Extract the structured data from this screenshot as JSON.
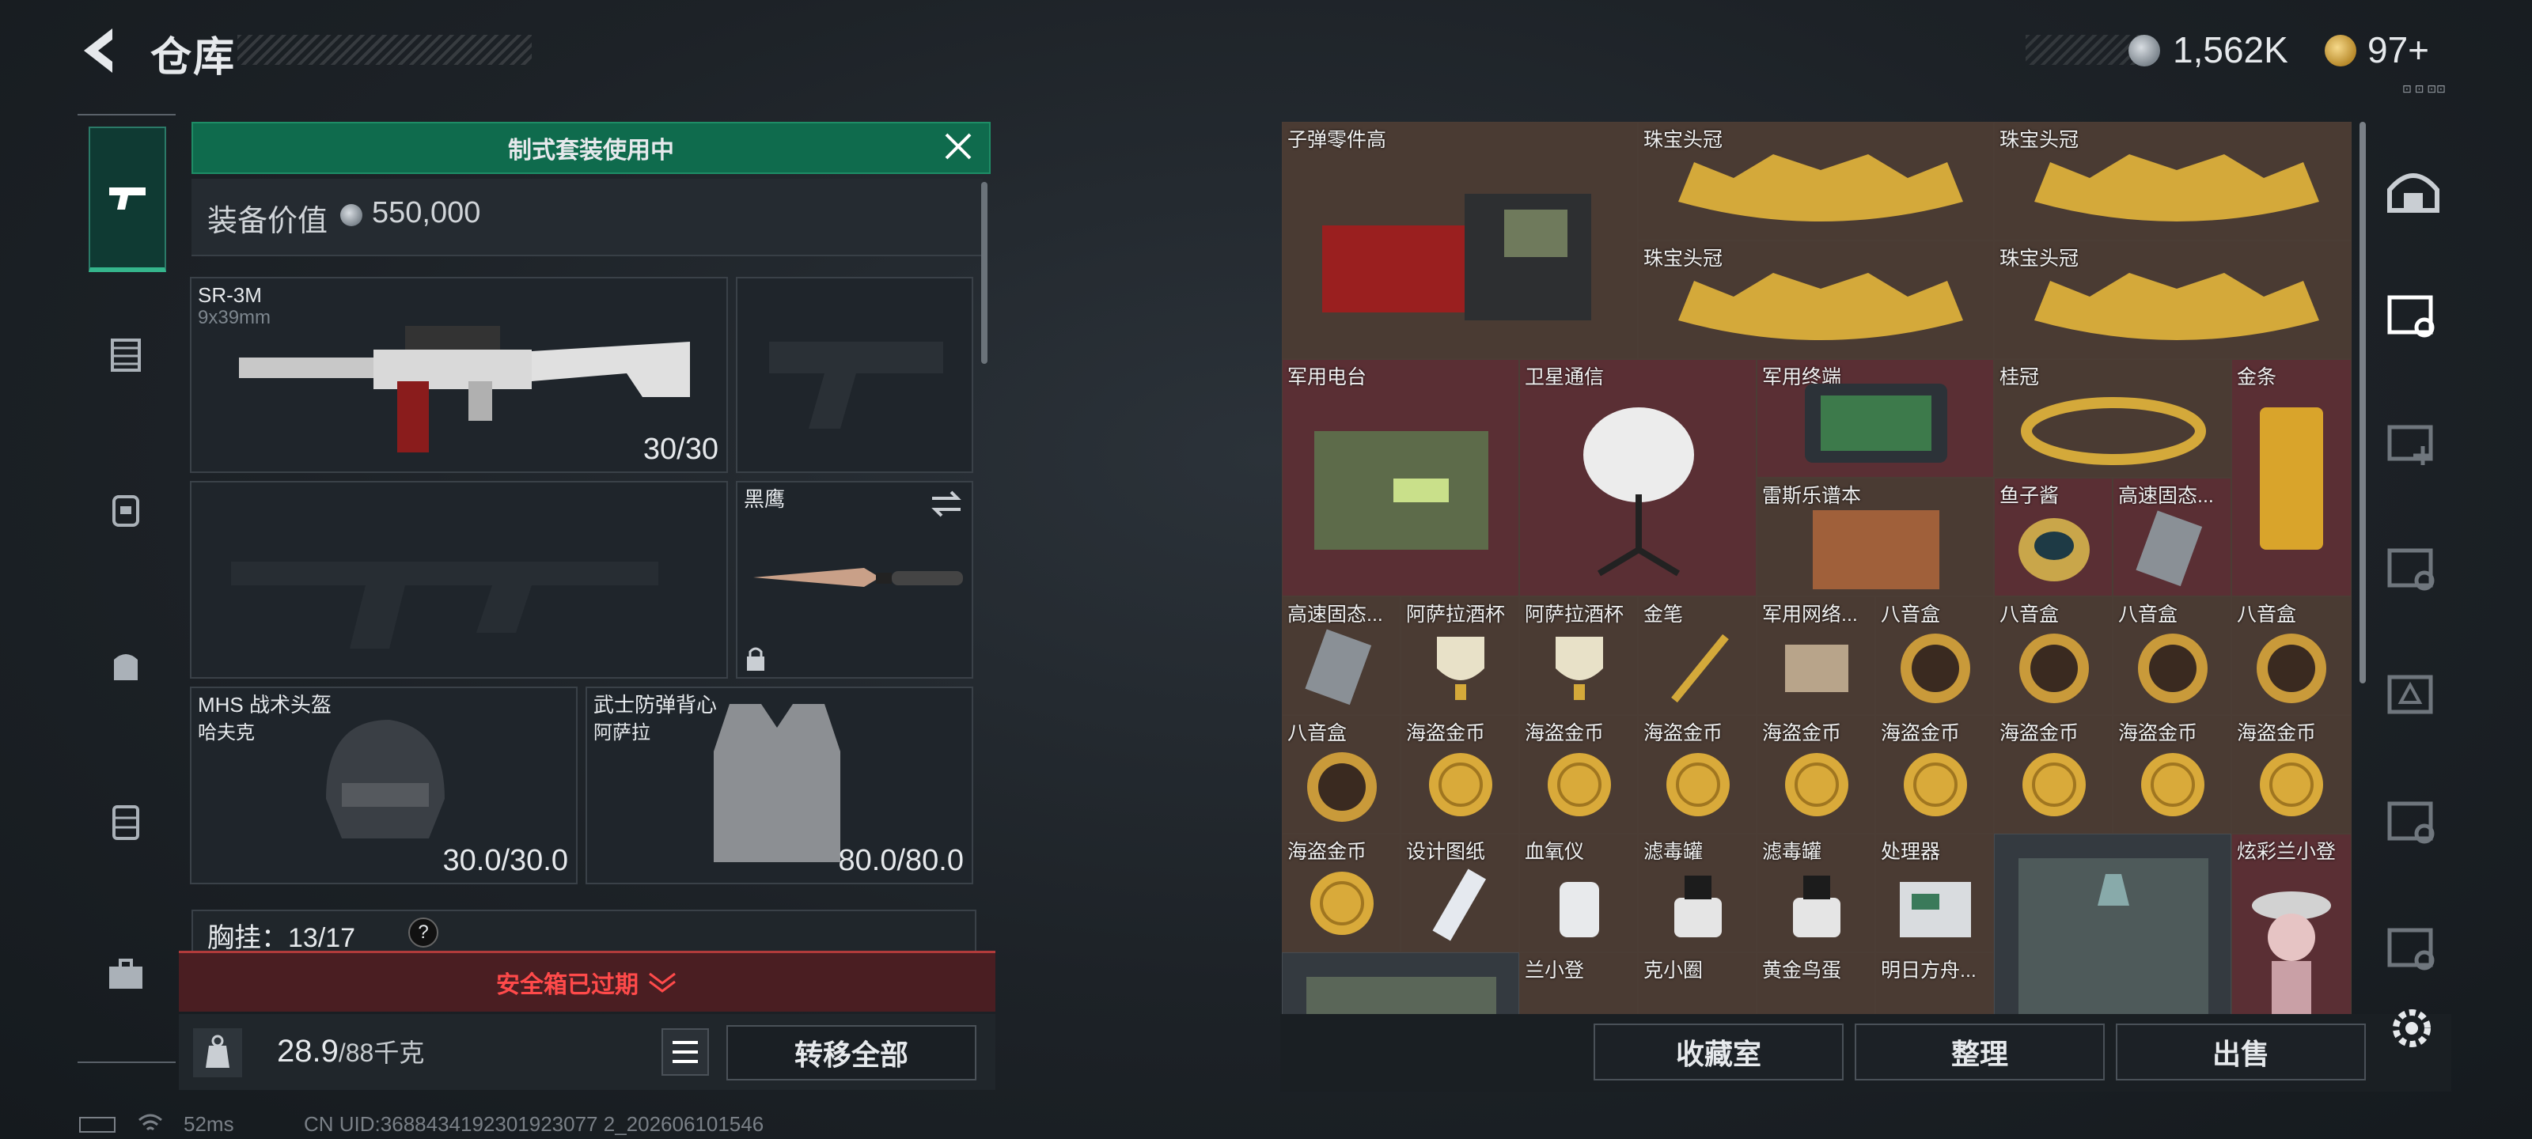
{
  "header": {
    "title": "仓库",
    "currency1": "1,562K",
    "currency2": "97+"
  },
  "top_right_mark": "⊡ ⊡ ⊡⊡",
  "loadout": {
    "banner": "制式套装使用中",
    "value_label": "装备价值",
    "value_amount": "550,000",
    "primary_weapon": {
      "name": "SR-3M",
      "sub": "9x39mm",
      "ammo": "30/30"
    },
    "melee": {
      "name": "黑鹰"
    },
    "helmet": {
      "name": "MHS 战术头盔",
      "sub": "哈夫克",
      "durability": "30.0/30.0"
    },
    "armor": {
      "name": "武士防弹背心",
      "sub": "阿萨拉",
      "durability": "80.0/80.0"
    },
    "chest_rig": {
      "label": "胸挂：13/17",
      "help": "?"
    },
    "safe_box": "安全箱已过期",
    "weight": "28.9",
    "weight_max": "/88千克",
    "transfer_all": "转移全部"
  },
  "storage": {
    "items": [
      {
        "label": "子弹零件高"
      },
      {
        "label": "珠宝头冠"
      },
      {
        "label": "珠宝头冠"
      },
      {
        "label": "珠宝头冠"
      },
      {
        "label": "珠宝头冠"
      },
      {
        "label": "军用电台"
      },
      {
        "label": "卫星通信"
      },
      {
        "label": "军用终端"
      },
      {
        "label": "桂冠"
      },
      {
        "label": "金条"
      },
      {
        "label": "雷斯乐谱本"
      },
      {
        "label": "鱼子酱"
      },
      {
        "label": "高速固态..."
      },
      {
        "label": "高速固态..."
      },
      {
        "label": "阿萨拉酒杯"
      },
      {
        "label": "阿萨拉酒杯"
      },
      {
        "label": "金笔"
      },
      {
        "label": "军用网络..."
      },
      {
        "label": "八音盒"
      },
      {
        "label": "八音盒"
      },
      {
        "label": "八音盒"
      },
      {
        "label": "八音盒"
      },
      {
        "label": "八音盒"
      },
      {
        "label": "海盗金币"
      },
      {
        "label": "海盗金币"
      },
      {
        "label": "海盗金币"
      },
      {
        "label": "海盗金币"
      },
      {
        "label": "海盗金币"
      },
      {
        "label": "海盗金币"
      },
      {
        "label": "海盗金币"
      },
      {
        "label": "海盗金币"
      },
      {
        "label": "海盗金币"
      },
      {
        "label": "设计图纸"
      },
      {
        "label": "血氧仪"
      },
      {
        "label": "滤毒罐"
      },
      {
        "label": "滤毒罐"
      },
      {
        "label": "处理器"
      },
      {
        "label": "炫彩兰小登"
      },
      {
        "label": "兰小登"
      },
      {
        "label": "克小圈"
      },
      {
        "label": "黄金鸟蛋"
      },
      {
        "label": "明日方舟..."
      }
    ]
  },
  "bottom_buttons": {
    "collection": "收藏室",
    "sort": "整理",
    "sell": "出售"
  },
  "status": {
    "ping": "52ms",
    "uid": "CN UID:3688434192301923077 2_202606101546"
  },
  "colors": {
    "accent_green": "#0f6b4d",
    "warning_red": "#ff4a4a",
    "rare_red": "#5a2f34",
    "rare_brown": "#4a3b33"
  }
}
